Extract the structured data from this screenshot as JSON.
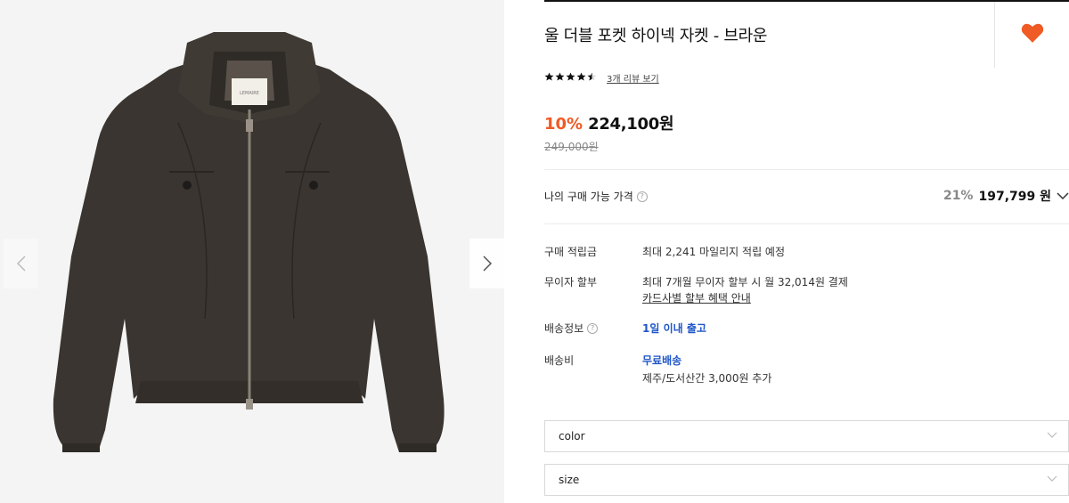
{
  "product": {
    "title": "울 더블 포켓 하이넥 자켓 - 브라운",
    "brand_label": "LEMAIRE",
    "rating": 4.5,
    "review_link": "3개 리뷰 보기",
    "discount": "10%",
    "price": "224,100원",
    "original_price": "249,000원"
  },
  "my_price": {
    "label": "나의 구매 가능 가격",
    "discount": "21%",
    "price": "197,799 원"
  },
  "info": [
    {
      "label": "구매 적립금",
      "value": "최대 2,241 마일리지 적립 예정"
    },
    {
      "label": "무이자 할부",
      "value": "최대 7개월 무이자 할부 시 월 32,014원 결제",
      "link": "카드사별 할부 혜택 안내"
    },
    {
      "label": "배송정보",
      "value": "1일 이내 출고"
    },
    {
      "label": "배송비",
      "value": "무료배송",
      "sub": "제주/도서산간 3,000원 추가"
    }
  ],
  "options": [
    {
      "placeholder": "color"
    },
    {
      "placeholder": "size"
    }
  ],
  "colors": {
    "accent": "#f05a24",
    "heart": "#f05a24",
    "link_blue": "#1f56c8",
    "jacket": "#3a3530"
  },
  "icons": {
    "prev": "chevron-left-icon",
    "next": "chevron-right-icon",
    "wish": "heart-icon",
    "help": "question-circle-icon",
    "dropdown": "chevron-down-icon"
  }
}
